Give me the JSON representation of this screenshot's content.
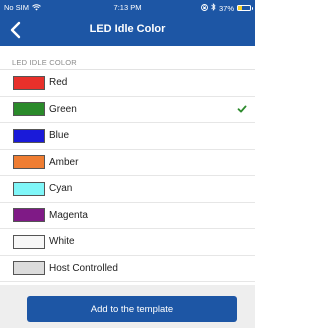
{
  "status_bar": {
    "carrier": "No SIM",
    "time": "7:13 PM",
    "battery_percent": "37%",
    "battery_level": 0.37,
    "wifi_icon": "wifi-icon",
    "lock_icon": "rotation-lock-icon",
    "bluetooth_icon": "bluetooth-icon"
  },
  "header": {
    "title": "LED Idle Color",
    "back_icon": "chevron-left-icon",
    "background": "#1d56a5"
  },
  "section": {
    "title": "LED IDLE COLOR"
  },
  "colors": [
    {
      "label": "Red",
      "swatch": "#e8302b",
      "selected": false
    },
    {
      "label": "Green",
      "swatch": "#2a8a2a",
      "selected": true
    },
    {
      "label": "Blue",
      "swatch": "#1a1ad9",
      "selected": false
    },
    {
      "label": "Amber",
      "swatch": "#ef7d32",
      "selected": false
    },
    {
      "label": "Cyan",
      "swatch": "#7ff6f8",
      "selected": false
    },
    {
      "label": "Magenta",
      "swatch": "#7f1a86",
      "selected": false
    },
    {
      "label": "White",
      "swatch": "#f7f7f7",
      "selected": false
    },
    {
      "label": "Host Controlled",
      "swatch": "#dcdcdc",
      "selected": false
    }
  ],
  "check_color": "#2e8b2e",
  "footer": {
    "button_label": "Add to the template"
  }
}
